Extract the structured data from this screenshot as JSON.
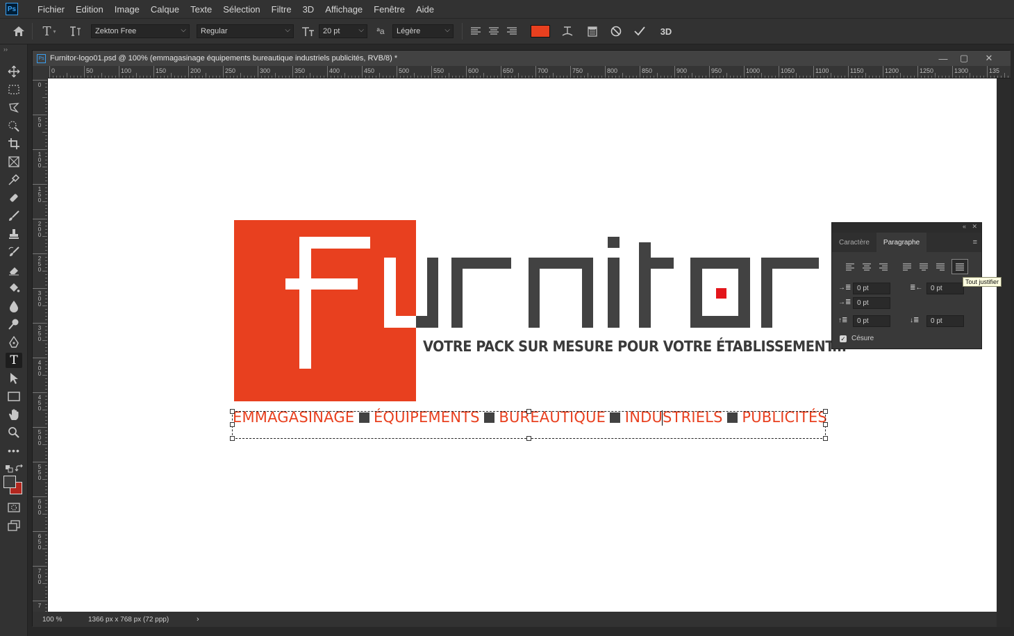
{
  "app": {
    "logo": "Ps"
  },
  "menu": [
    "Fichier",
    "Edition",
    "Image",
    "Calque",
    "Texte",
    "Sélection",
    "Filtre",
    "3D",
    "Affichage",
    "Fenêtre",
    "Aide"
  ],
  "options": {
    "font_family": "Zekton Free",
    "font_style": "Regular",
    "font_size": "20 pt",
    "antialias_glyph": "ªa",
    "antialias": "Légère",
    "text_color": "#e8401f",
    "three_d": "3D"
  },
  "document": {
    "title": "Furnitor-logo01.psd @ 100% (emmagasinage équipements bureautique industriels publicités, RVB/8) *",
    "zoom": "100 %",
    "dims": "1366 px x 768 px (72 ppp)",
    "ruler_top": [
      "0",
      "50",
      "100",
      "150",
      "200",
      "250",
      "300",
      "350",
      "400",
      "450",
      "500",
      "550",
      "600",
      "650",
      "700",
      "750",
      "800",
      "850",
      "900",
      "950",
      "1000",
      "1050",
      "1100",
      "1150",
      "1200",
      "1250",
      "1300",
      "135"
    ],
    "ruler_left": [
      "0",
      "5 0",
      "1 0 0",
      "1 5 0",
      "2 0 0",
      "2 5 0",
      "3 0 0",
      "3 5 0",
      "4 0 0",
      "4 5 0",
      "5 0 0",
      "5 5 0",
      "6 0 0",
      "6 5 0",
      "7 0 0",
      "7"
    ]
  },
  "artwork": {
    "tagline": "VOTRE PACK SUR MESURE POUR VOTRE ÉTABLISSEMENT...",
    "text_layer": [
      "EMMAGASINAGE",
      "ÉQUIPEMENTS",
      "BUREAUTIQUE",
      "INDUSTRIELS",
      "PUBLICITÉS"
    ],
    "brand_red": "#e8401f",
    "brand_grey": "#424242",
    "dot_red": "#e3161b"
  },
  "panel": {
    "tab_character": "Caractère",
    "tab_paragraph": "Paragraphe",
    "indent_left": "0 pt",
    "indent_right": "0 pt",
    "indent_first": "0 pt",
    "space_before": "0 pt",
    "space_after": "0 pt",
    "hyphenation": "Césure",
    "tooltip": "Tout justifier"
  }
}
